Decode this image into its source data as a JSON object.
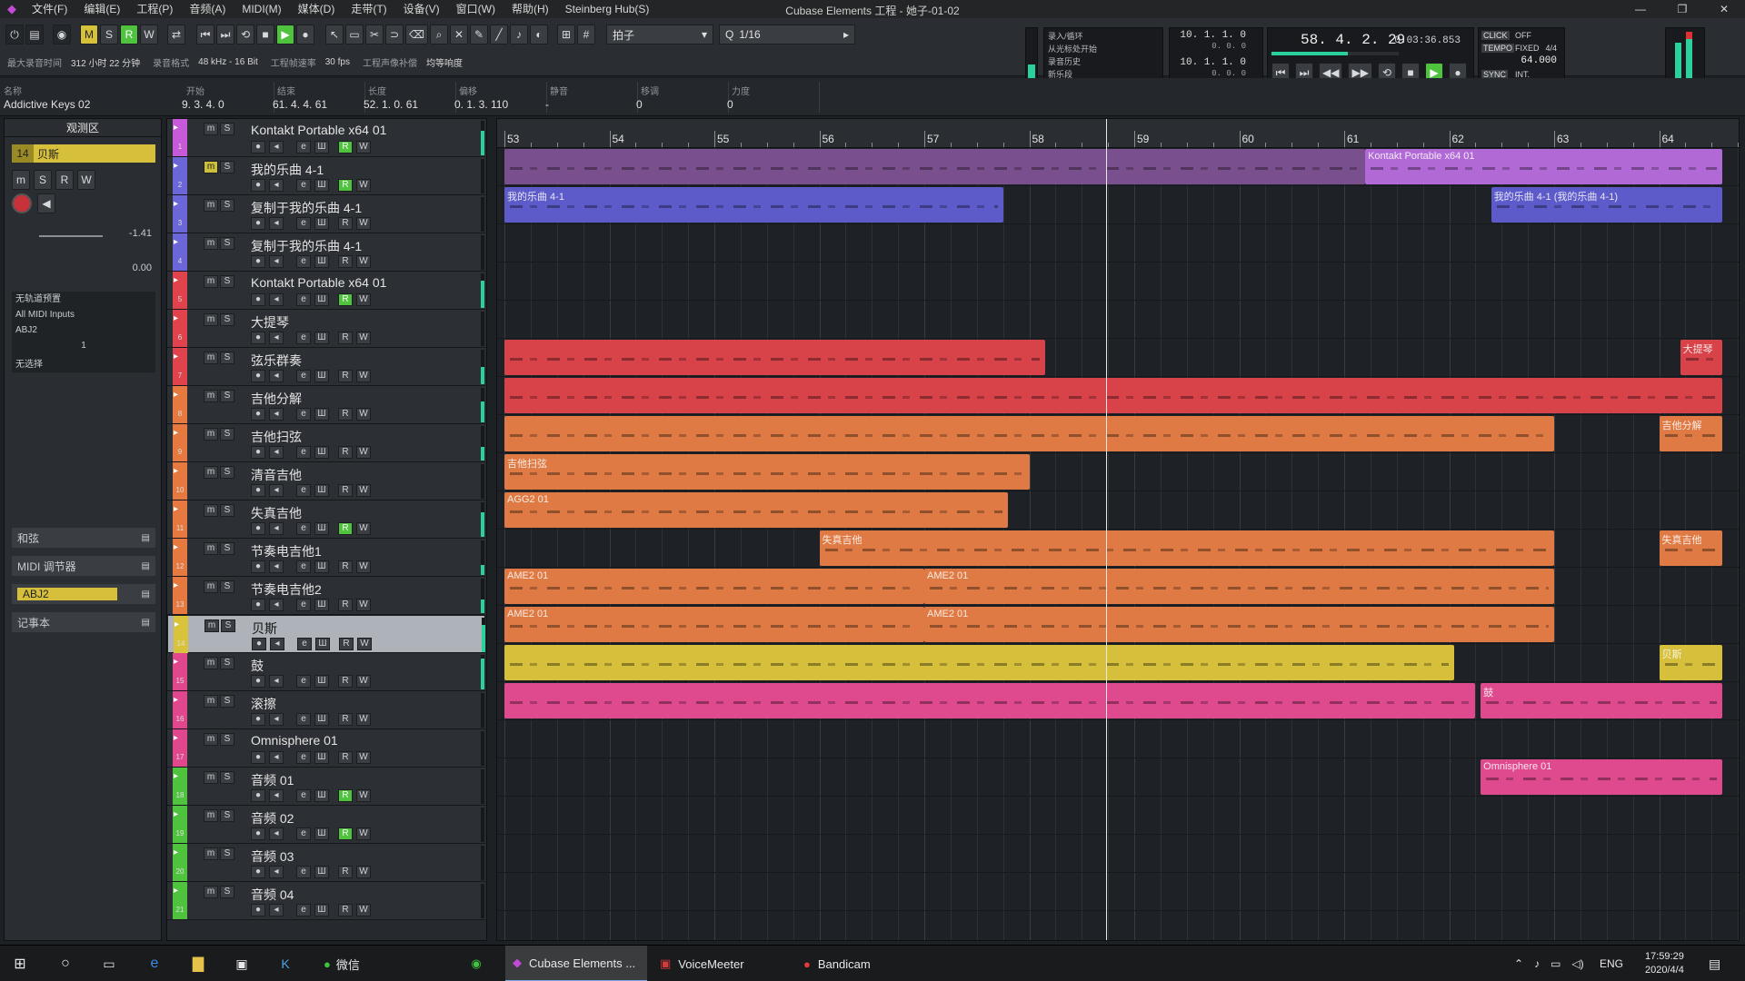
{
  "titlebar": {
    "title": "Cubase Elements 工程 - 她子-01-02",
    "menus": [
      "文件(F)",
      "编辑(E)",
      "工程(P)",
      "音频(A)",
      "MIDI(M)",
      "媒体(D)",
      "走带(T)",
      "设备(V)",
      "窗口(W)",
      "帮助(H)",
      "Steinberg Hub(S)"
    ],
    "min": "—",
    "max": "❐",
    "close": "✕"
  },
  "toolbar": {
    "snap_label": "拍子",
    "quantize_label": "1/16",
    "status": [
      {
        "label": "最大录音时间",
        "value": "312 小时 22 分钟"
      },
      {
        "label": "录音格式",
        "value": "48 kHz - 16 Bit"
      },
      {
        "label": "工程帧速率",
        "value": "30 fps"
      },
      {
        "label": "工程声像补偿",
        "value": "均等响度"
      }
    ],
    "buttons": {
      "m": "M",
      "s": "S",
      "r": "R",
      "w": "W"
    }
  },
  "transport": {
    "left_locator": "10. 1. 1. 0",
    "left_sub": "0. 0. 0",
    "right_locator": "10. 1. 1. 0",
    "right_sub": "0. 0. 0",
    "position": "58. 4. 2. 29",
    "time": "0:03:36.853",
    "click": "CLICK",
    "click_state": "OFF",
    "tempo_label": "TEMPO",
    "tempo_mode": "FIXED",
    "signature": "4/4",
    "tempo": "64.000",
    "sync": "SYNC",
    "sync_state": "INT.",
    "options": [
      "录入/循环",
      "从光标处开始",
      "录音历史",
      "新乐段"
    ]
  },
  "infoline": {
    "headers": [
      "名称",
      "开始",
      "结束",
      "长度",
      "偏移",
      "静音",
      "移调",
      "力度"
    ],
    "values": [
      "Addictive Keys 02",
      "9. 3. 4. 0",
      "61. 4. 4. 61",
      "52. 1. 0. 61",
      "0. 1. 3. 110",
      "-",
      "0",
      "0"
    ]
  },
  "inspector": {
    "title": "观测区",
    "track_num": "14",
    "track_name": "贝斯",
    "volume": "-1.41",
    "pan": "0.00",
    "no_preset": "无轨道预置",
    "midi_in": "All MIDI Inputs",
    "midi_out": "ABJ2",
    "channel": "1",
    "no_bank": "无选择",
    "sections": [
      "和弦",
      "MIDI 调节器",
      "ABJ2",
      "记事本"
    ]
  },
  "tracks": [
    {
      "num": "1",
      "name": "Kontakt Portable x64 01",
      "color": "#c65ad8",
      "rec": true,
      "m": false
    },
    {
      "num": "2",
      "name": "我的乐曲 4-1",
      "color": "#6c67d8",
      "rec": true,
      "m": true
    },
    {
      "num": "3",
      "name": "复制于我的乐曲 4-1",
      "color": "#6c67d8",
      "rec": false,
      "m": false
    },
    {
      "num": "4",
      "name": "复制于我的乐曲 4-1",
      "color": "#6c67d8",
      "rec": false,
      "m": false
    },
    {
      "num": "5",
      "name": "Kontakt Portable x64 01",
      "color": "#e0434b",
      "rec": true,
      "m": false
    },
    {
      "num": "6",
      "name": "大提琴",
      "color": "#e0434b",
      "rec": false,
      "m": false
    },
    {
      "num": "7",
      "name": "弦乐群奏",
      "color": "#e0434b",
      "rec": false,
      "m": false
    },
    {
      "num": "8",
      "name": "吉他分解",
      "color": "#e5793f",
      "rec": false,
      "m": false
    },
    {
      "num": "9",
      "name": "吉他扫弦",
      "color": "#e5793f",
      "rec": false,
      "m": false
    },
    {
      "num": "10",
      "name": "清音吉他",
      "color": "#e5793f",
      "rec": false,
      "m": false
    },
    {
      "num": "11",
      "name": "失真吉他",
      "color": "#e5793f",
      "rec": true,
      "m": false
    },
    {
      "num": "12",
      "name": "节奏电吉他1",
      "color": "#e5793f",
      "rec": false,
      "m": false
    },
    {
      "num": "13",
      "name": "节奏电吉他2",
      "color": "#e5793f",
      "rec": false,
      "m": false
    },
    {
      "num": "14",
      "name": "贝斯",
      "color": "#d8c33a",
      "rec": false,
      "m": false
    },
    {
      "num": "15",
      "name": "鼓",
      "color": "#e0478d",
      "rec": false,
      "m": false
    },
    {
      "num": "16",
      "name": "滚擦",
      "color": "#e0478d",
      "rec": false,
      "m": false
    },
    {
      "num": "17",
      "name": "Omnisphere 01",
      "color": "#e0478d",
      "rec": false,
      "m": false
    },
    {
      "num": "18",
      "name": "音频 01",
      "color": "#4fc33d",
      "rec": true,
      "m": false
    },
    {
      "num": "19",
      "name": "音频 02",
      "color": "#4fc33d",
      "rec": true,
      "m": false
    },
    {
      "num": "20",
      "name": "音频 03",
      "color": "#4fc33d",
      "rec": false,
      "m": false
    },
    {
      "num": "21",
      "name": "音频 04",
      "color": "#4fc33d",
      "rec": false,
      "m": false
    }
  ],
  "ruler": {
    "bars": [
      "53",
      "54",
      "55",
      "56",
      "57",
      "58",
      "59",
      "60",
      "61",
      "62",
      "63",
      "64"
    ]
  },
  "parts": [
    {
      "lane": 0,
      "start": 53,
      "end": 61.2,
      "color": "#7a4f8e",
      "label": ""
    },
    {
      "lane": 0,
      "start": 61.2,
      "end": 64.6,
      "color": "#b169d6",
      "label": "Kontakt Portable x64 01"
    },
    {
      "lane": 1,
      "start": 53,
      "end": 57.75,
      "color": "#5d5ac9",
      "label": "我的乐曲 4-1"
    },
    {
      "lane": 1,
      "start": 62.4,
      "end": 64.6,
      "color": "#5d5ac9",
      "label": "我的乐曲 4-1 (我的乐曲 4-1)"
    },
    {
      "lane": 5,
      "start": 53,
      "end": 58.15,
      "color": "#d8434a",
      "label": ""
    },
    {
      "lane": 5,
      "start": 64.2,
      "end": 64.6,
      "color": "#d8434a",
      "label": "大提琴"
    },
    {
      "lane": 6,
      "start": 53,
      "end": 64.6,
      "color": "#d8434a",
      "label": ""
    },
    {
      "lane": 7,
      "start": 53,
      "end": 63.0,
      "color": "#df7a44",
      "label": ""
    },
    {
      "lane": 7,
      "start": 64.0,
      "end": 64.6,
      "color": "#df7a44",
      "label": "吉他分解"
    },
    {
      "lane": 8,
      "start": 53,
      "end": 58.0,
      "color": "#df7a44",
      "label": "吉他扫弦"
    },
    {
      "lane": 9,
      "start": 53,
      "end": 57.8,
      "color": "#df7a44",
      "label": "AGG2 01"
    },
    {
      "lane": 10,
      "start": 56.0,
      "end": 63.0,
      "color": "#df7a44",
      "label": "失真吉他"
    },
    {
      "lane": 10,
      "start": 64.0,
      "end": 64.6,
      "color": "#df7a44",
      "label": "失真吉他"
    },
    {
      "lane": 11,
      "start": 53,
      "end": 57.0,
      "color": "#df7a44",
      "label": "AME2 01"
    },
    {
      "lane": 11,
      "start": 57.0,
      "end": 63.0,
      "color": "#df7a44",
      "label": "AME2 01"
    },
    {
      "lane": 12,
      "start": 53,
      "end": 57.0,
      "color": "#df7a44",
      "label": "AME2 01"
    },
    {
      "lane": 12,
      "start": 57.0,
      "end": 63.0,
      "color": "#df7a44",
      "label": "AME2 01"
    },
    {
      "lane": 13,
      "start": 53,
      "end": 62.05,
      "color": "#d6bf3a",
      "label": ""
    },
    {
      "lane": 13,
      "start": 64.0,
      "end": 64.6,
      "color": "#d6bf3a",
      "label": "贝斯"
    },
    {
      "lane": 14,
      "start": 53,
      "end": 62.25,
      "color": "#df4a8e",
      "label": ""
    },
    {
      "lane": 14,
      "start": 62.3,
      "end": 64.6,
      "color": "#df4a8e",
      "label": "鼓"
    },
    {
      "lane": 16,
      "start": 62.3,
      "end": 64.6,
      "color": "#df4a8e",
      "label": "Omnisphere 01"
    }
  ],
  "cursor_bar": 58.73,
  "taskbar": {
    "items": [
      "Cubase Elements ...",
      "VoiceMeeter",
      "Bandicam",
      "微信"
    ],
    "lang": "ENG",
    "time": "17:59:29",
    "date": "2020/4/4"
  }
}
